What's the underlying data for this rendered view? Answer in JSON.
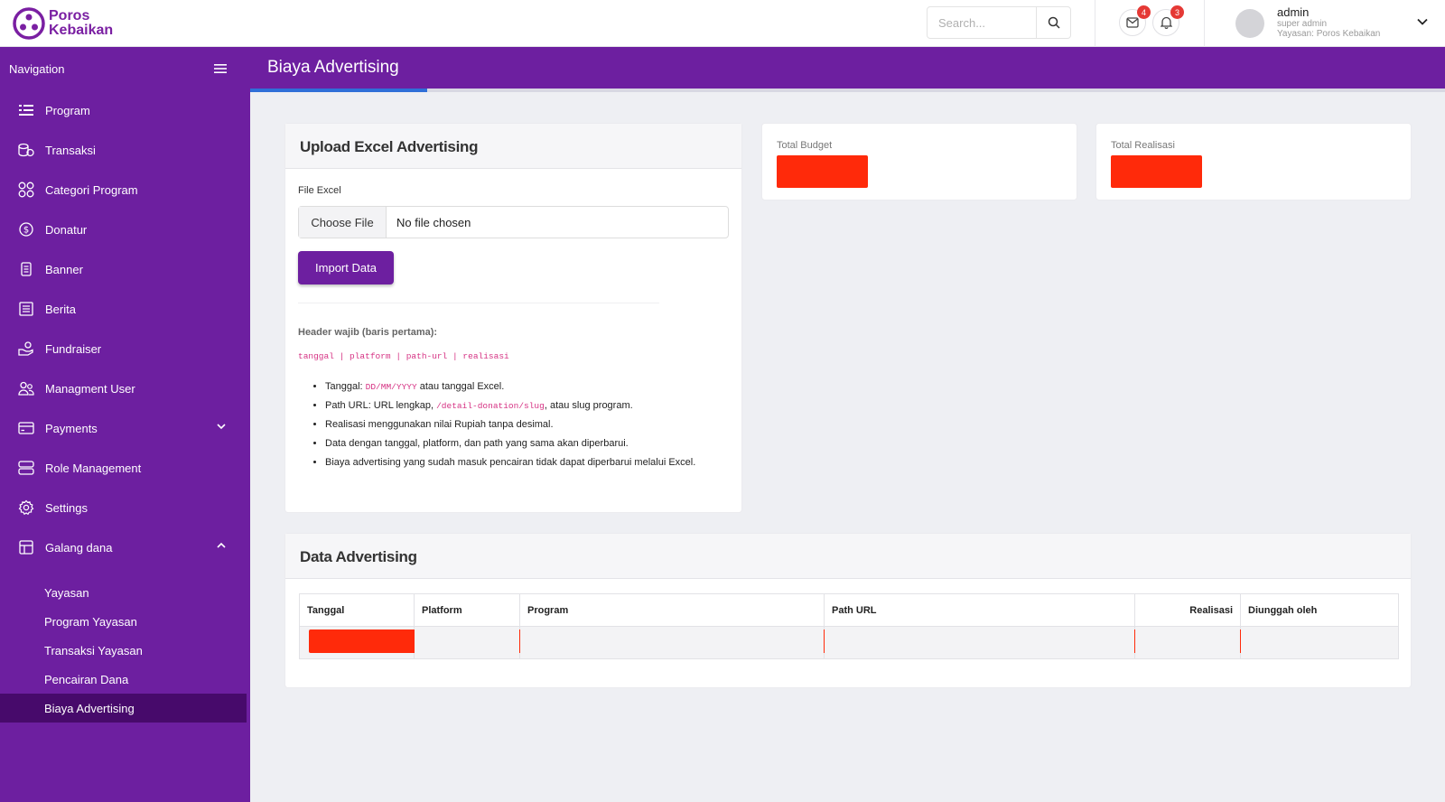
{
  "brand": {
    "line1": "Poros",
    "line2": "Kebaikan"
  },
  "search": {
    "placeholder": "Search..."
  },
  "notifications": {
    "mail_count": "4",
    "bell_count": "3"
  },
  "user": {
    "name": "admin",
    "role": "super admin",
    "org": "Yayasan: Poros Kebaikan"
  },
  "sidebar": {
    "heading": "Navigation",
    "items": [
      {
        "label": "Program",
        "icon": "list-icon"
      },
      {
        "label": "Transaksi",
        "icon": "coins-icon"
      },
      {
        "label": "Categori Program",
        "icon": "grid-icon"
      },
      {
        "label": "Donatur",
        "icon": "dollar-circle-icon"
      },
      {
        "label": "Banner",
        "icon": "document-icon"
      },
      {
        "label": "Berita",
        "icon": "news-icon"
      },
      {
        "label": "Fundraiser",
        "icon": "hand-coin-icon"
      },
      {
        "label": "Managment User",
        "icon": "users-icon"
      },
      {
        "label": "Payments",
        "icon": "card-icon"
      },
      {
        "label": "Role Management",
        "icon": "server-icon"
      },
      {
        "label": "Settings",
        "icon": "gear-icon"
      },
      {
        "label": "Galang dana",
        "icon": "layout-icon"
      }
    ],
    "sub_items": [
      {
        "label": "Yayasan"
      },
      {
        "label": "Program Yayasan"
      },
      {
        "label": "Transaksi Yayasan"
      },
      {
        "label": "Pencairan Dana"
      },
      {
        "label": "Biaya Advertising"
      }
    ]
  },
  "page": {
    "title": "Biaya Advertising"
  },
  "upload": {
    "title": "Upload Excel Advertising",
    "file_label": "File Excel",
    "choose_label": "Choose File",
    "chosen_text": "No file chosen",
    "import_label": "Import Data",
    "header_title": "Header wajib (baris pertama):",
    "header_code": "tanggal | platform | path-url | realisasi",
    "notes": {
      "n1_pre": "Tanggal: ",
      "n1_code": "DD/MM/YYYY",
      "n1_post": " atau tanggal Excel.",
      "n2_pre": "Path URL: URL lengkap, ",
      "n2_code": "/detail-donation/slug",
      "n2_post": ", atau slug program.",
      "n3": "Realisasi menggunakan nilai Rupiah tanpa desimal.",
      "n4": "Data dengan tanggal, platform, dan path yang sama akan diperbarui.",
      "n5": "Biaya advertising yang sudah masuk pencairan tidak dapat diperbarui melalui Excel."
    }
  },
  "stats": {
    "budget_label": "Total Budget",
    "realisasi_label": "Total Realisasi"
  },
  "data_table": {
    "title": "Data Advertising",
    "columns": [
      "Tanggal",
      "Platform",
      "Program",
      "Path URL",
      "Realisasi",
      "Diunggah oleh"
    ]
  },
  "colors": {
    "primary": "#6d1fa0",
    "active": "#470a6b",
    "redaction": "#ff2a0a",
    "accent_bar": "#2f6fd8"
  }
}
